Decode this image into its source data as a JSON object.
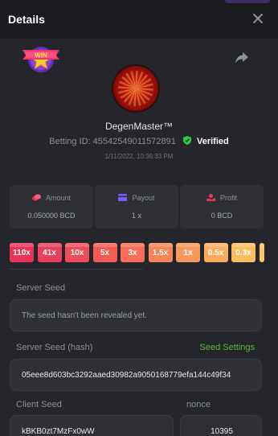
{
  "header": {
    "title": "Details"
  },
  "player": {
    "username": "DegenMaster™",
    "betting_id_label": "Betting ID:",
    "betting_id": "4554254901157289​1",
    "verified_label": "Verified",
    "timestamp": "1/11/2022, 10:36:33 PM"
  },
  "stats": {
    "amount": {
      "label": "Amount",
      "value": "0.050000 BCD"
    },
    "payout": {
      "label": "Payout",
      "value": "1 x"
    },
    "profit": {
      "label": "Profit",
      "value": "0 BCD"
    }
  },
  "multipliers": [
    {
      "label": "110x",
      "color": "#e8345b"
    },
    {
      "label": "41x",
      "color": "#ea3f5a"
    },
    {
      "label": "10x",
      "color": "#ee4d57"
    },
    {
      "label": "5x",
      "color": "#f25c54"
    },
    {
      "label": "3x",
      "color": "#f56e55"
    },
    {
      "label": "1.5x",
      "color": "#f78359"
    },
    {
      "label": "1x",
      "color": "#f8985c"
    },
    {
      "label": "0.5x",
      "color": "#f9ac5e"
    },
    {
      "label": "0.3x",
      "color": "#fabd60"
    },
    {
      "label": "",
      "color": "#fcc862"
    }
  ],
  "server_seed": {
    "label": "Server Seed",
    "value": "The seed hasn't been revealed yet."
  },
  "server_seed_hash": {
    "label": "Server Seed (hash)",
    "settings_link": "Seed Settings",
    "value": "05eee8d603bc3292aaed30982a9050168779efa144c49f34"
  },
  "client_seed": {
    "label": "Client Seed",
    "value": "kBKB0zt7MzFx0wW"
  },
  "nonce": {
    "label": "nonce",
    "value": "10395"
  },
  "colors": {
    "verified_green": "#2ecc40",
    "seed_settings": "#5fb83a",
    "payout_icon": "#7c5cff",
    "amount_icon": "#e8345b",
    "profit_icon": "#e8345b"
  }
}
